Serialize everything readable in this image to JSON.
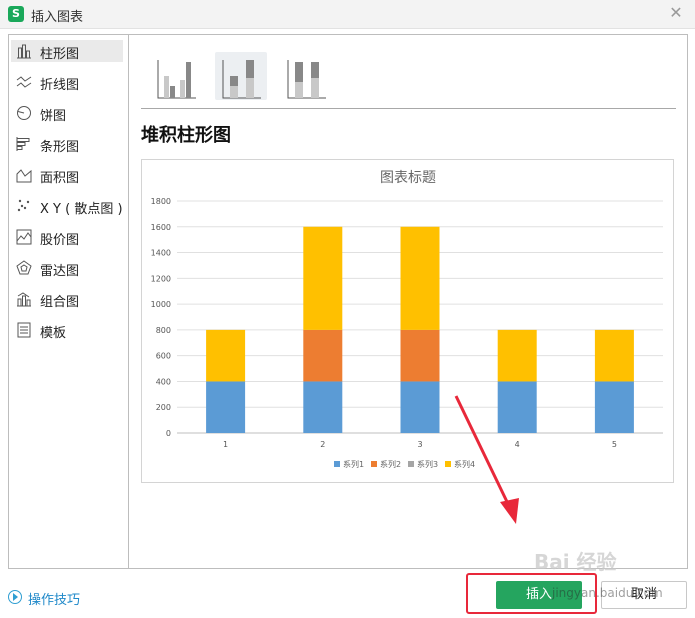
{
  "window": {
    "app_icon_letter": "S",
    "title": "插入图表"
  },
  "sidebar": {
    "items": [
      {
        "label": "柱形图",
        "icon": "column-chart-icon",
        "active": true
      },
      {
        "label": "折线图",
        "icon": "line-chart-icon"
      },
      {
        "label": "饼图",
        "icon": "pie-chart-icon"
      },
      {
        "label": "条形图",
        "icon": "bar-chart-icon"
      },
      {
        "label": "面积图",
        "icon": "area-chart-icon"
      },
      {
        "label": "X Y ( 散点图 )",
        "icon": "scatter-chart-icon"
      },
      {
        "label": "股价图",
        "icon": "stock-chart-icon"
      },
      {
        "label": "雷达图",
        "icon": "radar-chart-icon"
      },
      {
        "label": "组合图",
        "icon": "combo-chart-icon"
      },
      {
        "label": "模板",
        "icon": "template-icon"
      }
    ]
  },
  "subtypes": [
    {
      "name": "clustered-column-icon",
      "active": false
    },
    {
      "name": "stacked-column-icon",
      "active": true
    },
    {
      "name": "percent-stacked-column-icon",
      "active": false
    }
  ],
  "heading": "堆积柱形图",
  "chart_data": {
    "type": "bar",
    "stacked": true,
    "title": "图表标题",
    "categories": [
      "1",
      "2",
      "3",
      "4",
      "5"
    ],
    "series": [
      {
        "name": "系列1",
        "color": "#5b9bd5",
        "values": [
          400,
          400,
          400,
          400,
          400
        ]
      },
      {
        "name": "系列2",
        "color": "#ed7d31",
        "values": [
          0,
          400,
          400,
          0,
          0
        ]
      },
      {
        "name": "系列3",
        "color": "#a5a5a5",
        "values": [
          0,
          0,
          0,
          0,
          0
        ]
      },
      {
        "name": "系列4",
        "color": "#ffc000",
        "values": [
          400,
          800,
          800,
          400,
          400
        ]
      }
    ],
    "ylim": [
      0,
      1800
    ],
    "yticks": [
      "0",
      "200",
      "400",
      "600",
      "800",
      "1000",
      "1200",
      "1400",
      "1600",
      "1800"
    ],
    "grid": true,
    "legend_position": "bottom"
  },
  "footer": {
    "tip_label": "操作技巧",
    "insert_label": "插入",
    "cancel_label": "取消"
  },
  "watermark": {
    "main": "Bai 经验",
    "sub": "jingyan.baidu.com"
  },
  "colors": {
    "accent": "#25a55f",
    "link": "#1e88c9",
    "highlight": "#e8283a"
  }
}
